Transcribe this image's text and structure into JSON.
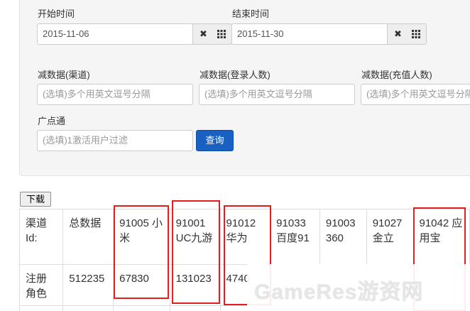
{
  "filters": {
    "start_label": "开始时间",
    "start_value": "2015-11-06",
    "end_label": "结束时间",
    "end_value": "2015-11-30",
    "clear_icon": "✖",
    "calendar_icon": "grid-icon",
    "minus_channel_label": "减数据(渠道)",
    "minus_login_label": "减数据(登录人数)",
    "minus_recharge_label": "减数据(充值人数)",
    "multi_placeholder": "(选填)多个用英文逗号分隔",
    "gdt_label": "广点通",
    "gdt_placeholder": "(选填)1激活用户过滤",
    "query_button": "查询"
  },
  "download_button": "下载",
  "table": {
    "headers": [
      "渠道Id:",
      "总数据",
      "91005 小米",
      "91001 UC九游",
      "91012 华为",
      "91033 百度91",
      "91003 360",
      "91027 金立",
      "91042 应用宝"
    ],
    "row_register": [
      "注册角色",
      "512235",
      "67830",
      "131023",
      "4740"
    ]
  },
  "watermark": "GameRes游资网",
  "highlight_color": "#e02020"
}
